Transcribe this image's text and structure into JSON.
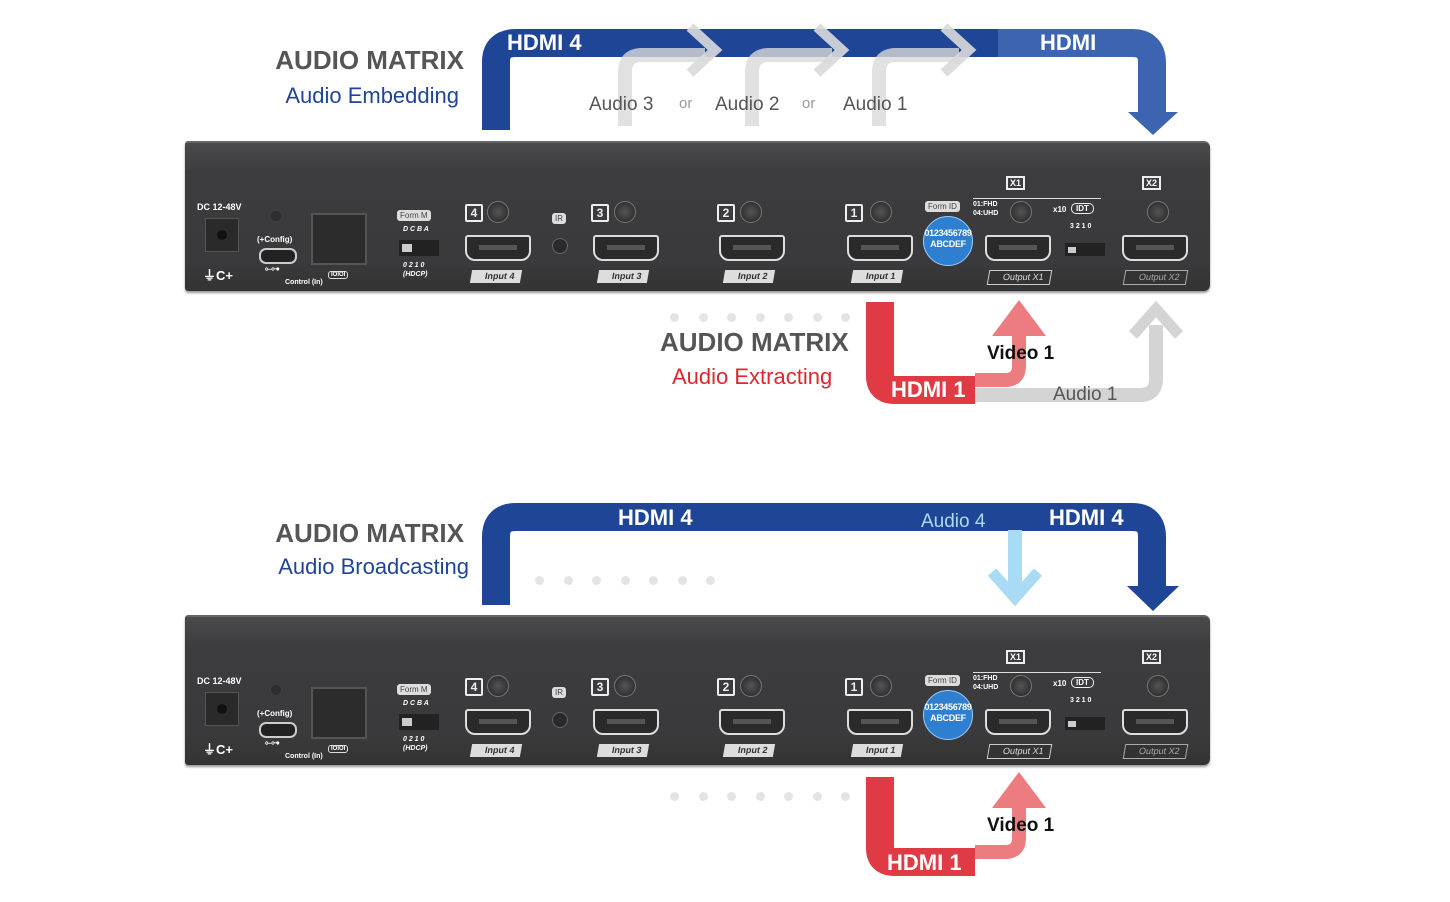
{
  "section_embedding": {
    "title": "AUDIO MATRIX",
    "subtitle": "Audio Embedding",
    "source_label": "HDMI 4",
    "output_label": "HDMI",
    "audio_options": [
      "Audio 3",
      "Audio 2",
      "Audio 1"
    ],
    "or_label": "or"
  },
  "section_extracting": {
    "title": "AUDIO MATRIX",
    "subtitle": "Audio Extracting",
    "source_label": "HDMI 1",
    "video_label": "Video 1",
    "audio_label": "Audio 1"
  },
  "section_broadcasting": {
    "title": "AUDIO MATRIX",
    "subtitle": "Audio Broadcasting",
    "source_label": "HDMI 4",
    "output_label": "HDMI 4",
    "audio_label": "Audio 4",
    "bottom_source_label": "HDMI 1",
    "video_label": "Video 1"
  },
  "device": {
    "dc_label": "DC 12-48V",
    "power_symbol": "⏚C+",
    "config_label": "(+Config)",
    "usb_symbol": "⟜⊶",
    "control_label": "Control (In)",
    "rs232_label": "IOIOI",
    "form_m": "Form M",
    "dip_letters": "D C B A",
    "dip_numbers": "0 2 1 0",
    "hdcp_label": "(HDCP)",
    "ir_label": "IR",
    "inputs": [
      {
        "number": "4",
        "label": "Input 4"
      },
      {
        "number": "3",
        "label": "Input 3"
      },
      {
        "number": "2",
        "label": "Input 2"
      },
      {
        "number": "1",
        "label": "Input 1"
      }
    ],
    "form_id": "Form ID",
    "rotary_digits": "0123456789ABCDEF",
    "resolution_1": "01:FHD",
    "resolution_2": "04:UHD",
    "x10_label": "x10",
    "idt_label": "IDT",
    "id_dip_numbers": "3 2 1 0",
    "outputs": [
      {
        "tag": "X1",
        "label": "Output X1"
      },
      {
        "tag": "X2",
        "label": "Output X2"
      }
    ]
  },
  "colors": {
    "blue": "#1f4597",
    "blue_light": "#3c64b0",
    "red": "#e03a44",
    "pink": "#ec7c80",
    "light_blue": "#a9dcf4",
    "gray_arrow": "#d4d4d4"
  }
}
